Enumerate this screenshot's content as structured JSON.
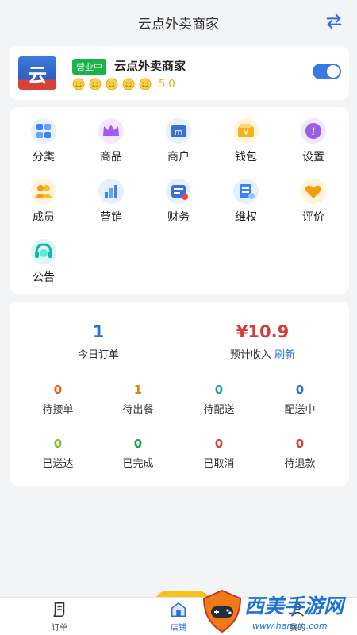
{
  "header": {
    "title": "云点外卖商家",
    "switch_icon": "swap-arrows-icon"
  },
  "store": {
    "logo_text": "云",
    "status_badge": "营业中",
    "name": "云点外卖商家",
    "rating_icons": 5,
    "rating_score": "5.0",
    "open_toggle_on": true
  },
  "menu": {
    "items": [
      {
        "label": "分类",
        "icon": "category-icon",
        "color": "#3b82f6"
      },
      {
        "label": "商品",
        "icon": "crown-icon",
        "color": "#a855f7"
      },
      {
        "label": "商户",
        "icon": "merchant-icon",
        "color": "#3b6fd8"
      },
      {
        "label": "钱包",
        "icon": "wallet-icon",
        "color": "#f5b21b"
      },
      {
        "label": "设置",
        "icon": "info-settings-icon",
        "color": "#9b5de5"
      },
      {
        "label": "成员",
        "icon": "members-icon",
        "color": "#f59e0b"
      },
      {
        "label": "营销",
        "icon": "marketing-chart-icon",
        "color": "#3b82f6"
      },
      {
        "label": "财务",
        "icon": "finance-card-icon",
        "color": "#3b6fd8"
      },
      {
        "label": "维权",
        "icon": "rights-doc-icon",
        "color": "#3b82f6"
      },
      {
        "label": "评价",
        "icon": "heart-icon",
        "color": "#f59e0b"
      },
      {
        "label": "公告",
        "icon": "announcement-headset-icon",
        "color": "#14b8a6"
      }
    ]
  },
  "summary": {
    "today_orders": {
      "value": "1",
      "label": "今日订单",
      "color": "#2a6fde"
    },
    "income": {
      "value": "¥10.9",
      "label": "预计收入",
      "refresh": "刷新",
      "color": "#d63b3b"
    }
  },
  "stats": [
    {
      "value": "0",
      "label": "待接单",
      "color": "#e8601c"
    },
    {
      "value": "1",
      "label": "待出餐",
      "color": "#d98a0b"
    },
    {
      "value": "0",
      "label": "待配送",
      "color": "#22a39a"
    },
    {
      "value": "0",
      "label": "配送中",
      "color": "#2a6fde"
    },
    {
      "value": "0",
      "label": "已送达",
      "color": "#7cc12e"
    },
    {
      "value": "0",
      "label": "已完成",
      "color": "#1aa04c"
    },
    {
      "value": "0",
      "label": "已取消",
      "color": "#d63b3b"
    },
    {
      "value": "0",
      "label": "待退款",
      "color": "#d63b3b"
    }
  ],
  "tabbar": {
    "tabs": [
      {
        "label": "订单",
        "icon": "orders-icon"
      },
      {
        "label": "店铺",
        "icon": "store-icon"
      },
      {
        "label": "我的",
        "icon": "profile-icon"
      }
    ]
  },
  "watermark": {
    "brand": "西美手游网",
    "url": "www.hanxm.com"
  }
}
